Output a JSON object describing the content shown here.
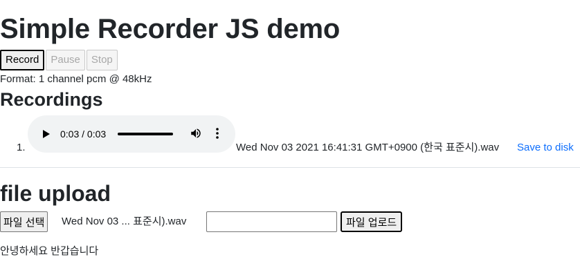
{
  "header": {
    "title": "Simple Recorder JS demo"
  },
  "controls": {
    "record_label": "Record",
    "pause_label": "Pause",
    "stop_label": "Stop"
  },
  "format_text": "Format: 1 channel pcm @ 48kHz",
  "recordings": {
    "heading": "Recordings",
    "items": [
      {
        "number": "1.",
        "time_display": "0:03 / 0:03",
        "name": "Wed Nov 03 2021 16:41:31 GMT+0900 (한국 표준시).wav",
        "save_label": "Save to disk"
      }
    ]
  },
  "upload": {
    "heading": "file upload",
    "choose_file_label": "파일 선택",
    "chosen_file": "Wed Nov 03 ... 표준시).wav",
    "text_value": "",
    "upload_label": "파일 업로드"
  },
  "greeting": "안녕하세요 반갑습니다"
}
